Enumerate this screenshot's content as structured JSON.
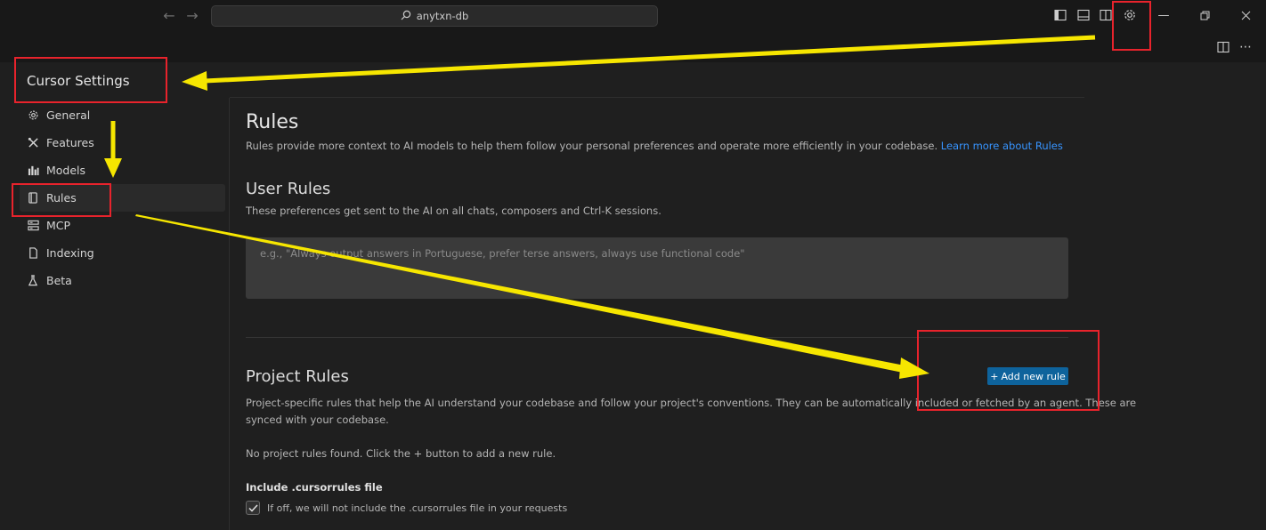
{
  "titlebar": {
    "search_text": "anytxn-db",
    "back_icon": "arrow-left-icon",
    "forward_icon": "arrow-right-icon"
  },
  "settings": {
    "title": "Cursor Settings"
  },
  "sidebar": {
    "items": [
      {
        "label": "General",
        "icon": "gear-icon"
      },
      {
        "label": "Features",
        "icon": "tools-icon"
      },
      {
        "label": "Models",
        "icon": "bar-chart-icon"
      },
      {
        "label": "Rules",
        "icon": "book-icon"
      },
      {
        "label": "MCP",
        "icon": "server-icon"
      },
      {
        "label": "Indexing",
        "icon": "file-icon"
      },
      {
        "label": "Beta",
        "icon": "flask-icon"
      }
    ]
  },
  "rules": {
    "title": "Rules",
    "description": "Rules provide more context to AI models to help them follow your personal preferences and operate more efficiently in your codebase.",
    "link_text": "Learn more about Rules"
  },
  "user_rules": {
    "title": "User Rules",
    "description": "These preferences get sent to the AI on all chats, composers and Ctrl-K sessions.",
    "placeholder": "e.g., \"Always output answers in Portuguese, prefer terse answers, always use functional code\""
  },
  "project_rules": {
    "title": "Project Rules",
    "add_button": "Add new rule",
    "description_line1": "Project-specific rules that help the AI understand your codebase and follow your project's conventions. They can be automatically included or fetched by an agent. These are",
    "description_line2": "synced with your codebase.",
    "empty_message": "No project rules found. Click the + button to add a new rule.",
    "cursorrules_label": "Include .cursorrules file",
    "cursorrules_hint": "If off, we will not include the .cursorrules file in your requests",
    "cursorrules_checked": true
  },
  "colors": {
    "accent": "#0e639c",
    "link": "#3794ff",
    "annotation_box": "#e8232c",
    "annotation_arrow": "#f6e600"
  }
}
